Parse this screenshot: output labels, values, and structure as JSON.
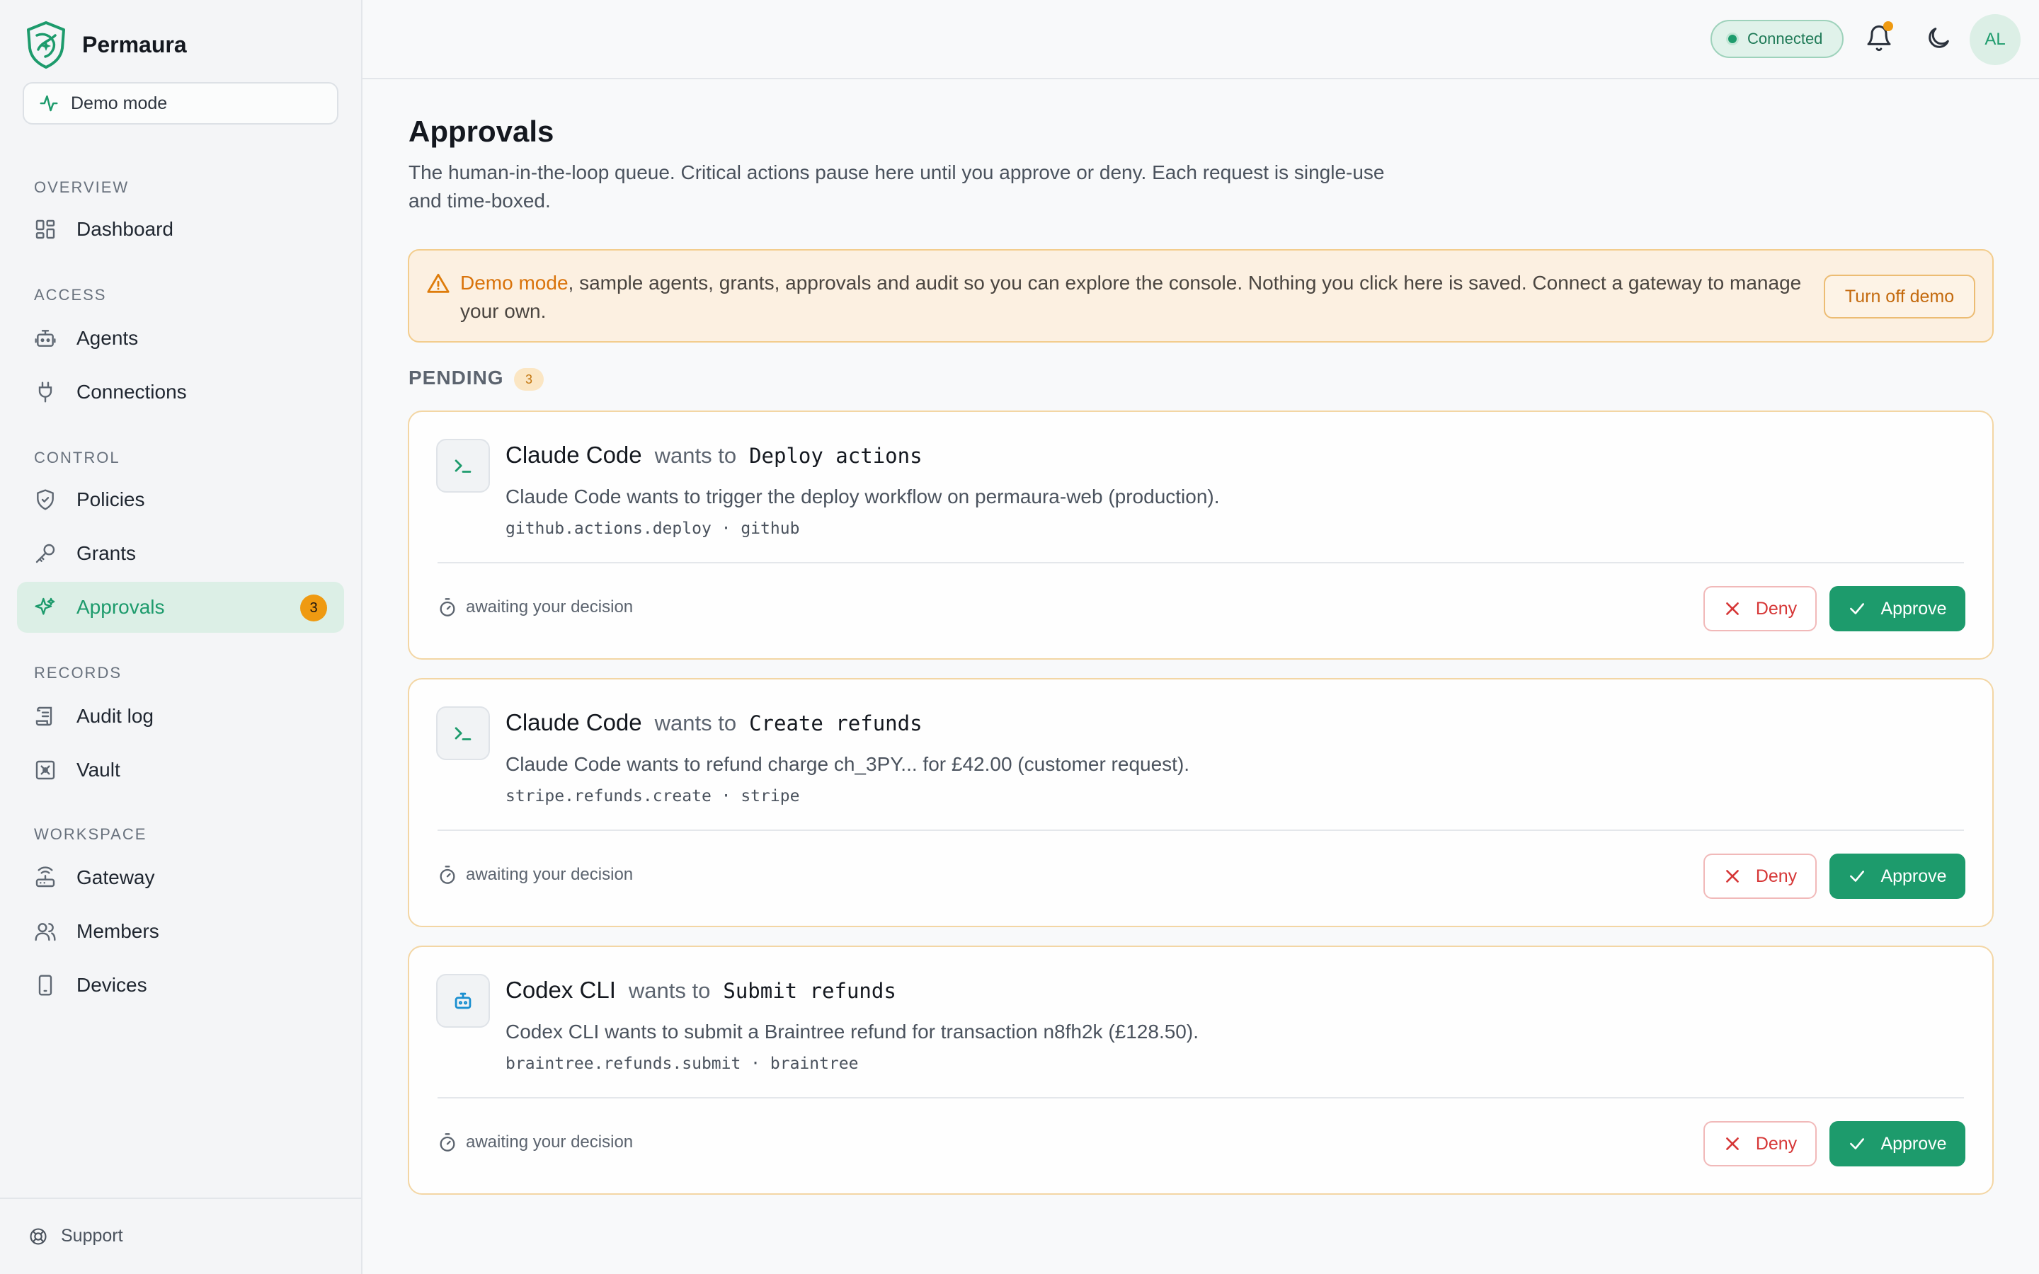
{
  "app": {
    "brand": "Permaura",
    "demo_pill": "Demo mode"
  },
  "sidebar": {
    "sections": {
      "overview": "OVERVIEW",
      "access": "ACCESS",
      "control": "CONTROL",
      "records": "RECORDS",
      "workspace": "WORKSPACE"
    },
    "items": {
      "dashboard": "Dashboard",
      "agents": "Agents",
      "connections": "Connections",
      "policies": "Policies",
      "grants": "Grants",
      "approvals": "Approvals",
      "approvals_badge": "3",
      "audit_log": "Audit log",
      "vault": "Vault",
      "gateway": "Gateway",
      "members": "Members",
      "devices": "Devices"
    },
    "support": "Support"
  },
  "topbar": {
    "status": "Connected",
    "avatar_initials": "AL"
  },
  "page": {
    "title": "Approvals",
    "description": "The human-in-the-loop queue. Critical actions pause here until you approve or deny. Each request is single-use and time-boxed."
  },
  "banner": {
    "strong": "Demo mode",
    "text": ", sample agents, grants, approvals and audit so you can explore the console. Nothing you click here is saved. Connect a gateway to manage your own.",
    "button": "Turn off demo"
  },
  "pending": {
    "label": "PENDING",
    "count": "3"
  },
  "requests": [
    {
      "agent": "Claude Code",
      "wants": "wants to",
      "action": "Deploy actions",
      "description": "Claude Code wants to trigger the deploy workflow on permaura-web (production).",
      "scope": "github.actions.deploy · github",
      "status": "awaiting your decision",
      "deny": "Deny",
      "approve": "Approve",
      "icon": "terminal-icon"
    },
    {
      "agent": "Claude Code",
      "wants": "wants to",
      "action": "Create refunds",
      "description": "Claude Code wants to refund charge ch_3PY... for £42.00 (customer request).",
      "scope": "stripe.refunds.create · stripe",
      "status": "awaiting your decision",
      "deny": "Deny",
      "approve": "Approve",
      "icon": "terminal-icon"
    },
    {
      "agent": "Codex CLI",
      "wants": "wants to",
      "action": "Submit refunds",
      "description": "Codex CLI wants to submit a Braintree refund for transaction n8fh2k (£128.50).",
      "scope": "braintree.refunds.submit · braintree",
      "status": "awaiting your decision",
      "deny": "Deny",
      "approve": "Approve",
      "icon": "bot-icon"
    }
  ],
  "colors": {
    "accent": "#1d9b6c",
    "warning": "#ef9a11",
    "danger": "#d63636"
  }
}
